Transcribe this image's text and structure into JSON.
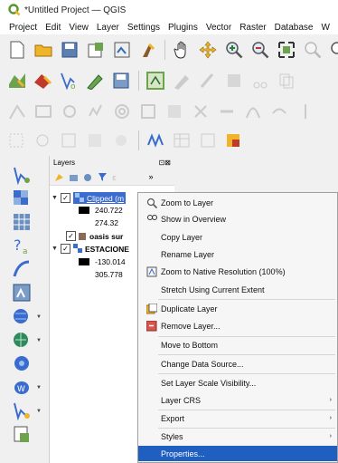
{
  "window": {
    "title": "*Untitled Project — QGIS"
  },
  "menubar": [
    "Project",
    "Edit",
    "View",
    "Layer",
    "Settings",
    "Plugins",
    "Vector",
    "Raster",
    "Database",
    "W"
  ],
  "layers_panel": {
    "title": "Layers",
    "layers": [
      {
        "name": "Clipped (m",
        "value1": "240.722",
        "value2": "274.32"
      },
      {
        "name": "oasis sur"
      },
      {
        "name": "ESTACIONE",
        "value1": "-130.014",
        "value2": "305.778"
      }
    ]
  },
  "context_menu": {
    "items": [
      "Zoom to Layer",
      "Show in Overview",
      "Copy Layer",
      "Rename Layer",
      "Zoom to Native Resolution (100%)",
      "Stretch Using Current Extent",
      "Duplicate Layer",
      "Remove Layer...",
      "Move to Bottom",
      "Change Data Source...",
      "Set Layer Scale Visibility...",
      "Layer CRS",
      "Export",
      "Styles",
      "Properties..."
    ],
    "highlighted": "Properties..."
  },
  "colors": {
    "selection": "#3a6ccf",
    "menu_highlight": "#1f5fbf",
    "qgis_green": "#589632",
    "qgis_yellow": "#f0b429"
  }
}
